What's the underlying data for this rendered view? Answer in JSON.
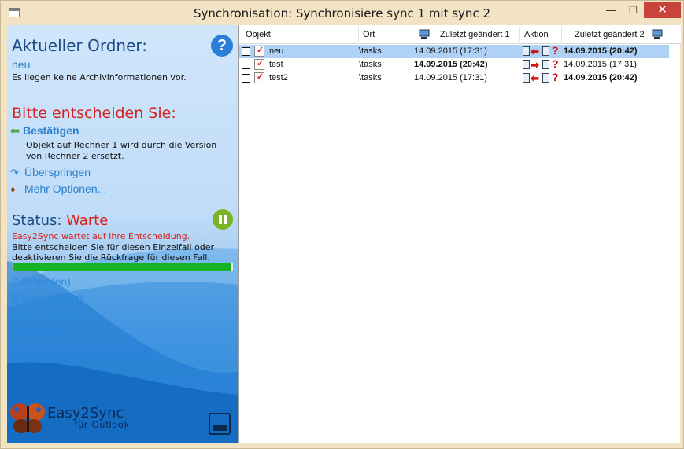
{
  "window": {
    "title": "Synchronisation: Synchronisiere sync 1 mit sync 2",
    "minimize": "—",
    "maximize": "☐",
    "close": "✕"
  },
  "left": {
    "current_folder_label": "Aktueller Ordner:",
    "folder_name": "neu",
    "archive_info": "Es liegen keine Archivinformationen vor.",
    "decide_label": "Bitte entscheiden Sie:",
    "confirm_label": "Bestätigen",
    "confirm_desc_1": "Objekt auf Rechner 1 wird durch die Version",
    "confirm_desc_2": "von Rechner 2 ersetzt.",
    "skip_label": "Überspringen",
    "more_label": "Mehr Optionen...",
    "status_label": "Status:",
    "status_value": "Warte",
    "status_message": "Easy2Sync wartet auf Ihre Entscheidung.",
    "status_hint_1": "Bitte entscheiden Sie für diesen Einzelfall oder",
    "status_hint_2": "deaktivieren Sie die Rückfrage für diesen Fall.",
    "progress": 0.99,
    "actions": "0 Aktion(en)",
    "messages": "3 Meldung(en)",
    "problems": "39 Problem(e)",
    "done": "0% Fertig",
    "logo": "Easy2Sync",
    "logo_sub": "für Outlook",
    "help_glyph": "?"
  },
  "table": {
    "headers": {
      "object": "Objekt",
      "location": "Ort",
      "changed1": "Zuletzt geändert 1",
      "action": "Aktion",
      "changed2": "Zuletzt geändert 2"
    },
    "rows": [
      {
        "name": "neu",
        "location": "\\tasks",
        "changed1": "14.09.2015 (17:31)",
        "changed2": "14.09.2015 (20:42)",
        "direction": "left",
        "bold1": false,
        "bold2": true,
        "selected": true
      },
      {
        "name": "test",
        "location": "\\tasks",
        "changed1": "14.09.2015 (20:42)",
        "changed2": "14.09.2015 (17:31)",
        "direction": "right",
        "bold1": true,
        "bold2": false,
        "selected": false
      },
      {
        "name": "test2",
        "location": "\\tasks",
        "changed1": "14.09.2015 (17:31)",
        "changed2": "14.09.2015 (20:42)",
        "direction": "left",
        "bold1": false,
        "bold2": true,
        "selected": false
      }
    ]
  },
  "glyphs": {
    "arrow_left": "⬅",
    "arrow_right": "➡",
    "question": "?",
    "confirm_icon": "⇦",
    "skip_icon": "↷",
    "more_icon": "♦"
  },
  "colors": {
    "title_bg": "#f2e3c4",
    "close_bg": "#c7433b",
    "selected_row": "#aed1f5",
    "accent_red": "#d8201c",
    "accent_blue": "#2a7fcc",
    "progress_green": "#17b324"
  }
}
